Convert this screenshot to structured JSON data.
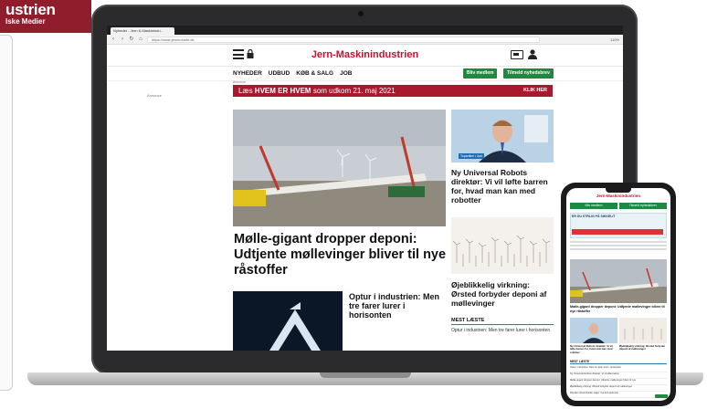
{
  "brand": {
    "name": "ustrien",
    "subtitle": "lske Medier"
  },
  "browser": {
    "tab_title": "Nyheder - Jern & Maskinindu...",
    "url": "https://www.jernindustri.dk",
    "zoom": "110%"
  },
  "site": {
    "logo": "Jern-Maskinindustrien",
    "nav": [
      "NYHEDER",
      "UDBUD",
      "KØB & SALG",
      "JOB"
    ],
    "btn_member": "Bliv medlem",
    "btn_newsletter": "Tilmeld nyhedsbrev",
    "ad_label": "Annonce",
    "side_ad": "Annonce",
    "banner_pre": "Læs ",
    "banner_bold": "HVEM ER HVEM",
    "banner_post": " som udkom 21. maj 2021",
    "banner_cta": "KLIK HER"
  },
  "articles": {
    "main_title": "Mølle-gigant dropper deponi: Udtjente møllevinger bliver til nye råstoffer",
    "small_title": "Optur i industrien: Men tre farer lurer i horisonten",
    "right1_tag": "Topartikel i Juni",
    "right1_title": "Ny Universal Robots direktør: Vi vil løfte barren for, hvad man kan med robotter",
    "right2_title": "Øjeblikkelig virkning: Ørsted forbyder deponi af møllevinger"
  },
  "most_read": {
    "heading": "MEST LÆSTE",
    "item": "Optur i industrien: Men tre farer lurer i horisonten"
  },
  "phone": {
    "logo": "Jern-Maskinindustrien",
    "btn_member": "Bliv medlem",
    "btn_newsletter": "Tilmeld nyhedsbrev",
    "ad_text": "ER DU STRLIG PÅ SIKKELIT",
    "title": "Mølle-gigant dropper deponi: Udtjente møllevinger bliver til nye råstoffer",
    "cap1": "Ny Universal Robots direktør: Vi vil løfte barren for, hvad man kan med robotter",
    "cap2": "Øjeblikkelig virkning: Ørsted forbyder deponi af møllevinger",
    "most": "MEST LÆSTE",
    "rows": [
      "Optur i industrien: Men tre farer lurer i horisonten",
      "Ny Universal Robots direktør: Vi vil løfte barren",
      "Mølle-gigant dropper deponi: Udtjente møllevinger bliver til nye",
      "Øjeblikkelig virkning: Ørsted forbyder deponi af møllevinger",
      "Danske virksomheder søger nye kompetencer"
    ]
  },
  "colors": {
    "brand_red": "#c8102e",
    "banner_red": "#a8192e",
    "green": "#1d8a3f",
    "card_red": "#8f1d2c"
  }
}
